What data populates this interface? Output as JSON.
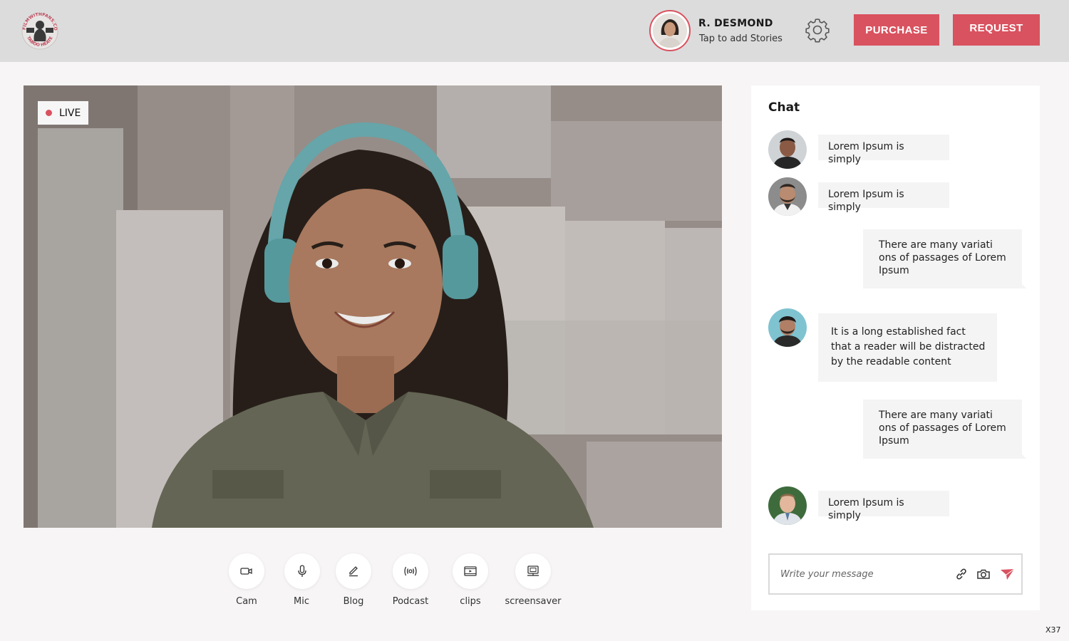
{
  "header": {
    "logo_text_top": "FILMWITHFANS.COM",
    "logo_text_bottom": "TABOO HEATED",
    "profile_name": "R. DESMOND",
    "profile_subtitle": "Tap to add Stories",
    "purchase_label": "PURCHASE",
    "request_label": "REQUEST"
  },
  "video": {
    "live_label": "LIVE"
  },
  "controls": [
    {
      "label": "Cam",
      "icon": "camera-icon"
    },
    {
      "label": "Mic",
      "icon": "mic-icon"
    },
    {
      "label": "Blog",
      "icon": "pencil-icon"
    },
    {
      "label": "Podcast",
      "icon": "broadcast-icon"
    },
    {
      "label": "clips",
      "icon": "video-clip-icon"
    },
    {
      "label": "screensaver",
      "icon": "screensaver-icon"
    }
  ],
  "chat": {
    "title": "Chat",
    "messages": [
      {
        "side": "left",
        "text": "Lorem Ipsum is simply"
      },
      {
        "side": "left",
        "text": "Lorem Ipsum is simply"
      },
      {
        "side": "right",
        "text": "There are many variati ons of passages of Lorem Ipsum"
      },
      {
        "side": "left",
        "text": "It is a long established fact that a reader will be distracted by the readable content"
      },
      {
        "side": "right",
        "text": "There are many variati ons of passages of Lorem Ipsum"
      },
      {
        "side": "left",
        "text": "Lorem Ipsum is simply"
      }
    ],
    "input_placeholder": "Write your message"
  },
  "footer": {
    "code": "X37"
  },
  "colors": {
    "accent": "#d9525f",
    "header_bg": "#dcdcdc",
    "page_bg": "#f7f5f5"
  }
}
